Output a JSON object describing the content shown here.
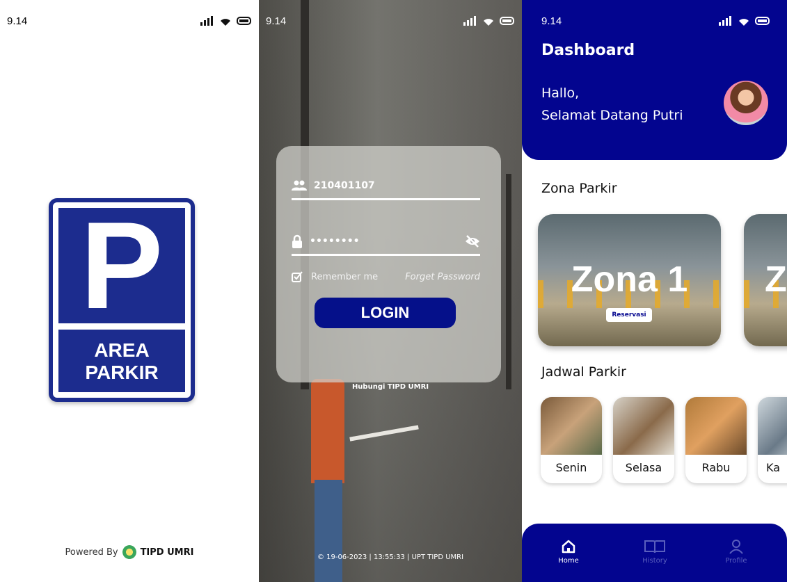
{
  "status_time": "9.14",
  "splash": {
    "sign_letter": "P",
    "sign_text_line1": "AREA",
    "sign_text_line2": "PARKIR",
    "powered_by": "Powered By",
    "brand": "TIPD UMRI"
  },
  "login": {
    "username_value": "210401107",
    "password_value": "••••••••",
    "remember_label": "Remember me",
    "forget_label": "Forget Password",
    "login_button": "LOGIN",
    "contact_link": "Hubungi TIPD UMRI",
    "footer": "© 19-06-2023 | 13:55:33 | UPT TIPD UMRI"
  },
  "dashboard": {
    "title": "Dashboard",
    "greeting_line1": "Hallo,",
    "greeting_line2": "Selamat Datang Putri",
    "zona_section": "Zona Parkir",
    "zones": [
      {
        "name": "Zona 1",
        "button": "Reservasi"
      },
      {
        "name": "Z",
        "button": ""
      }
    ],
    "jadwal_section": "Jadwal Parkir",
    "days": [
      "Senin",
      "Selasa",
      "Rabu",
      "Ka"
    ],
    "nav": [
      {
        "label": "Home",
        "icon": "home-icon",
        "active": true
      },
      {
        "label": "History",
        "icon": "book-icon",
        "active": false
      },
      {
        "label": "Profile",
        "icon": "user-icon",
        "active": false
      }
    ]
  },
  "colors": {
    "primary": "#03058f",
    "sign_blue": "#1c2c8e",
    "nav_inactive": "#5a5fbd"
  }
}
